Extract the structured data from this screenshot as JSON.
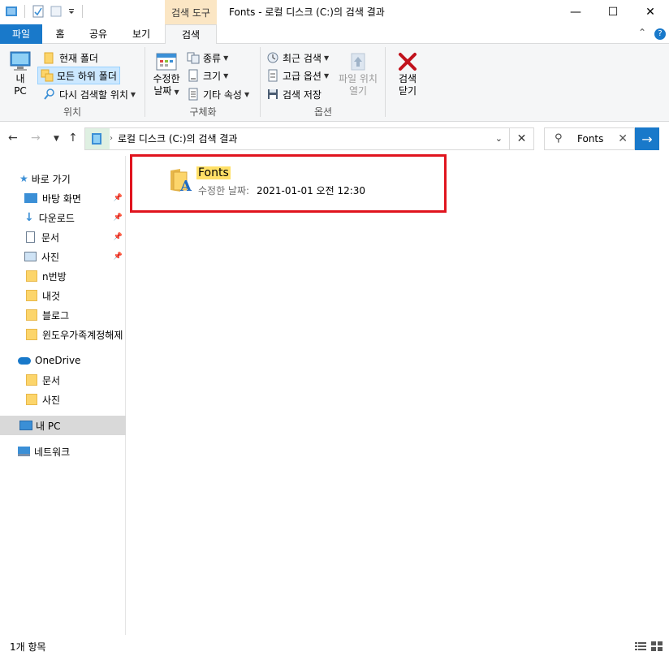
{
  "titlebar": {
    "tool_tab": "검색 도구",
    "title": "Fonts - 로컬 디스크 (C:)의 검색 결과",
    "minimize": "—",
    "maximize": "☐",
    "close": "✕"
  },
  "tabs": {
    "file": "파일",
    "home": "홈",
    "share": "공유",
    "view": "보기",
    "search": "검색",
    "collapse": "⌃",
    "help": "?"
  },
  "ribbon": {
    "location": {
      "this_pc_line1": "내",
      "this_pc_line2": "PC",
      "current_folder": "현재 폴더",
      "all_subfolders": "모든 하위 폴더",
      "search_again": "다시 검색할 위치",
      "label": "위치"
    },
    "refine": {
      "date_modified_line1": "수정한",
      "date_modified_line2": "날짜",
      "kind": "종류",
      "size": "크기",
      "other_props": "기타 속성",
      "label": "구체화"
    },
    "options": {
      "recent": "최근 검색",
      "advanced": "고급 옵션",
      "save": "검색 저장",
      "open_location_line1": "파일 위치",
      "open_location_line2": "열기",
      "label": "옵션"
    },
    "close_search_line1": "검색",
    "close_search_line2": "닫기"
  },
  "address": {
    "path": "로컬 디스크 (C:)의 검색 결과"
  },
  "search": {
    "value": "Fonts"
  },
  "nav": {
    "quick_access": "바로 가기",
    "items": [
      {
        "label": "바탕 화면",
        "pinned": true
      },
      {
        "label": "다운로드",
        "pinned": true
      },
      {
        "label": "문서",
        "pinned": true
      },
      {
        "label": "사진",
        "pinned": true
      },
      {
        "label": "n번방"
      },
      {
        "label": "내것"
      },
      {
        "label": "블로그"
      },
      {
        "label": "윈도우가족계정해제"
      }
    ],
    "onedrive": "OneDrive",
    "onedrive_items": [
      "문서",
      "사진"
    ],
    "this_pc": "내 PC",
    "network": "네트워크"
  },
  "result": {
    "name": "Fonts",
    "meta_label": "수정한 날짜:",
    "meta_value": "2021-01-01 오전 12:30"
  },
  "status": {
    "count": "1개 항목"
  },
  "colors": {
    "accent": "#1979ca",
    "highlight_box": "#e0141e",
    "name_highlight": "#ffe067"
  }
}
